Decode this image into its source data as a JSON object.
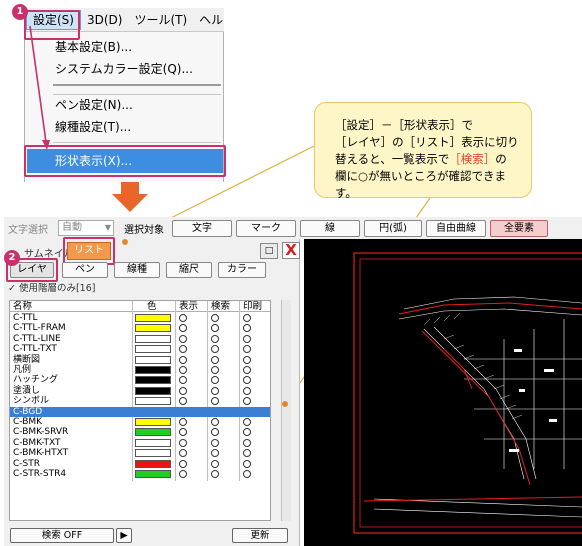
{
  "menu": {
    "items": [
      "設定(S)",
      "3D(D)",
      "ツール(T)",
      "ヘルプ"
    ],
    "dropdown": [
      "基本設定(B)...",
      "システムカラー設定(Q)...",
      "ペン設定(N)...",
      "線種設定(T)...",
      "形状表示(X)..."
    ]
  },
  "badges": [
    "1",
    "2"
  ],
  "callout": {
    "line1": "［設定］－［形状表示］で",
    "line2": "［レイヤ］の［リスト］表示に切り",
    "line3a": "替えると、一覧表示で",
    "line3b": "［検索］",
    "line3c": "の",
    "line4": "欄に○が無いところが確認できます。"
  },
  "toolbar": {
    "char_select": "文字選択",
    "combo_value": "自動",
    "select_target": "選択対象",
    "buttons": [
      "文字",
      "マーク",
      "線",
      "円(弧)",
      "自由曲線",
      "全要素"
    ]
  },
  "panel": {
    "tab_thumbnail": "サムネイル",
    "tab_list": "リスト",
    "pin": "□",
    "close": "X",
    "subtabs": [
      "レイヤ",
      "ペン",
      "線種",
      "縮尺",
      "カラー"
    ],
    "checkbox_label": "✓ 使用階層のみ[16]",
    "columns": [
      "名称",
      "色",
      "表示",
      "検索",
      "印刷"
    ],
    "rows": [
      {
        "name": "C-TTL",
        "color": "#ffff00",
        "show": 1,
        "search": 1,
        "print": 1
      },
      {
        "name": "C-TTL-FRAM",
        "color": "#ffff00",
        "show": 1,
        "search": 1,
        "print": 1
      },
      {
        "name": "C-TTL-LINE",
        "color": "#ffffff",
        "show": 1,
        "search": 1,
        "print": 1
      },
      {
        "name": "C-TTL-TXT",
        "color": "#ffffff",
        "show": 1,
        "search": 1,
        "print": 1
      },
      {
        "name": "横断図",
        "color": "#ffffff",
        "show": 1,
        "search": 1,
        "print": 1
      },
      {
        "name": "凡例",
        "color": "#000000",
        "show": 1,
        "search": 1,
        "print": 1
      },
      {
        "name": "ハッチング",
        "color": "#000000",
        "show": 1,
        "search": 1,
        "print": 1
      },
      {
        "name": "塗潰し",
        "color": "#000000",
        "show": 1,
        "search": 1,
        "print": 1
      },
      {
        "name": "シンボル",
        "color": "#ffffff",
        "show": 1,
        "search": 1,
        "print": 1
      },
      {
        "name": "C-BGD",
        "color": "#ffffff",
        "show": 1,
        "search": 1,
        "print": 1,
        "selected": true
      },
      {
        "name": "C-BMK",
        "color": "#ffff00",
        "show": 1,
        "search": 1,
        "print": 1
      },
      {
        "name": "C-BMK-SRVR",
        "color": "#22cc22",
        "show": 1,
        "search": 1,
        "print": 1
      },
      {
        "name": "C-BMK-TXT",
        "color": "#ffffff",
        "show": 1,
        "search": 1,
        "print": 1
      },
      {
        "name": "C-BMK-HTXT",
        "color": "#ffffff",
        "show": 1,
        "search": 1,
        "print": 1
      },
      {
        "name": "C-STR",
        "color": "#ee1111",
        "show": 1,
        "search": 1,
        "print": 1
      },
      {
        "name": "C-STR-STR4",
        "color": "#22cc22",
        "show": 1,
        "search": 1,
        "print": 1
      }
    ],
    "search_off": "検索 OFF",
    "play": "▶",
    "update": "更新"
  }
}
